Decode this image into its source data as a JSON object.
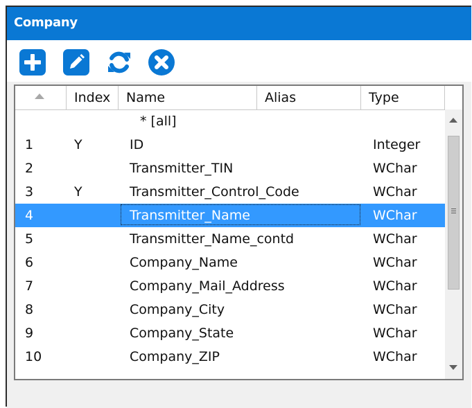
{
  "window": {
    "title": "Company"
  },
  "toolbar": {
    "buttons": [
      {
        "icon": "plus-icon"
      },
      {
        "icon": "edit-pencil-icon"
      },
      {
        "icon": "refresh-icon"
      },
      {
        "icon": "remove-x-icon"
      }
    ],
    "accent": "#0a78d4"
  },
  "table": {
    "columns": [
      "Index",
      "Name",
      "Alias",
      "Type"
    ],
    "sort_column": "row-number",
    "rows": [
      {
        "num": "",
        "index": "",
        "name": "* [all]",
        "alias": "",
        "type": ""
      },
      {
        "num": "1",
        "index": "Y",
        "name": "ID",
        "alias": "",
        "type": "Integer"
      },
      {
        "num": "2",
        "index": "",
        "name": "Transmitter_TIN",
        "alias": "",
        "type": "WChar"
      },
      {
        "num": "3",
        "index": "Y",
        "name": "Transmitter_Control_Code",
        "alias": "",
        "type": "WChar"
      },
      {
        "num": "4",
        "index": "",
        "name": "Transmitter_Name",
        "alias": "",
        "type": "WChar"
      },
      {
        "num": "5",
        "index": "",
        "name": "Transmitter_Name_contd",
        "alias": "",
        "type": "WChar"
      },
      {
        "num": "6",
        "index": "",
        "name": "Company_Name",
        "alias": "",
        "type": "WChar"
      },
      {
        "num": "7",
        "index": "",
        "name": "Company_Mail_Address",
        "alias": "",
        "type": "WChar"
      },
      {
        "num": "8",
        "index": "",
        "name": "Company_City",
        "alias": "",
        "type": "WChar"
      },
      {
        "num": "9",
        "index": "",
        "name": "Company_State",
        "alias": "",
        "type": "WChar"
      },
      {
        "num": "10",
        "index": "",
        "name": "Company_ZIP",
        "alias": "",
        "type": "WChar"
      }
    ],
    "selected_row_number": "4",
    "selection_color": "#3399ff"
  }
}
